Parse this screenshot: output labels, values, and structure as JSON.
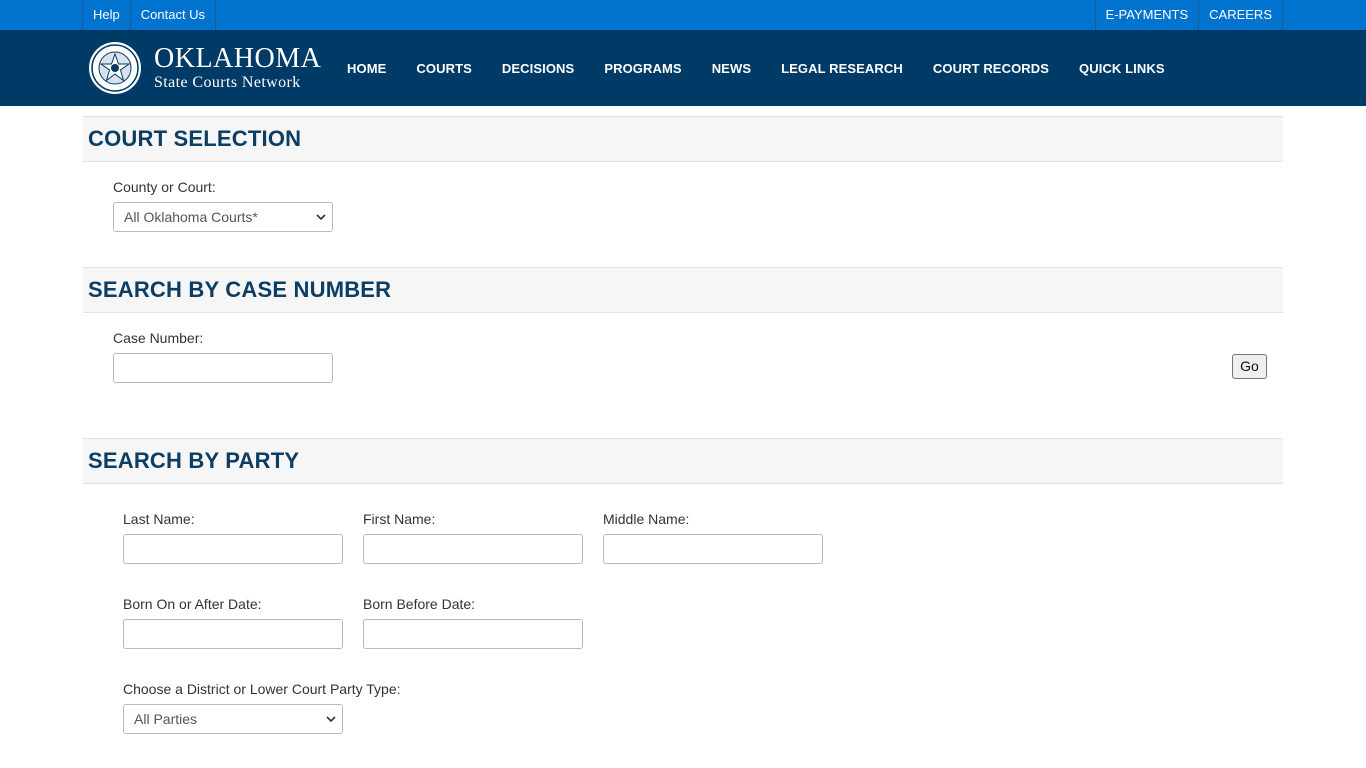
{
  "utility": {
    "left": [
      "Help",
      "Contact Us"
    ],
    "right": [
      "E-PAYMENTS",
      "CAREERS"
    ]
  },
  "logo": {
    "title": "OKLAHOMA",
    "subtitle": "State Courts Network"
  },
  "nav": [
    "HOME",
    "COURTS",
    "DECISIONS",
    "PROGRAMS",
    "NEWS",
    "LEGAL RESEARCH",
    "COURT RECORDS",
    "QUICK LINKS"
  ],
  "court_selection": {
    "title": "COURT SELECTION",
    "county_label": "County or Court:",
    "county_value": "All Oklahoma Courts*"
  },
  "case_number": {
    "title": "SEARCH BY CASE NUMBER",
    "label": "Case Number:",
    "value": "",
    "go_label": "Go"
  },
  "party": {
    "title": "SEARCH BY PARTY",
    "last_name_label": "Last Name:",
    "first_name_label": "First Name:",
    "middle_name_label": "Middle Name:",
    "born_after_label": "Born On or After Date:",
    "born_before_label": "Born Before Date:",
    "party_type_label": "Choose a District or Lower Court Party Type:",
    "party_type_value": "All Parties"
  },
  "colors": {
    "utility_bar": "#0073cf",
    "header": "#003a66",
    "section_title": "#0c3d62"
  }
}
